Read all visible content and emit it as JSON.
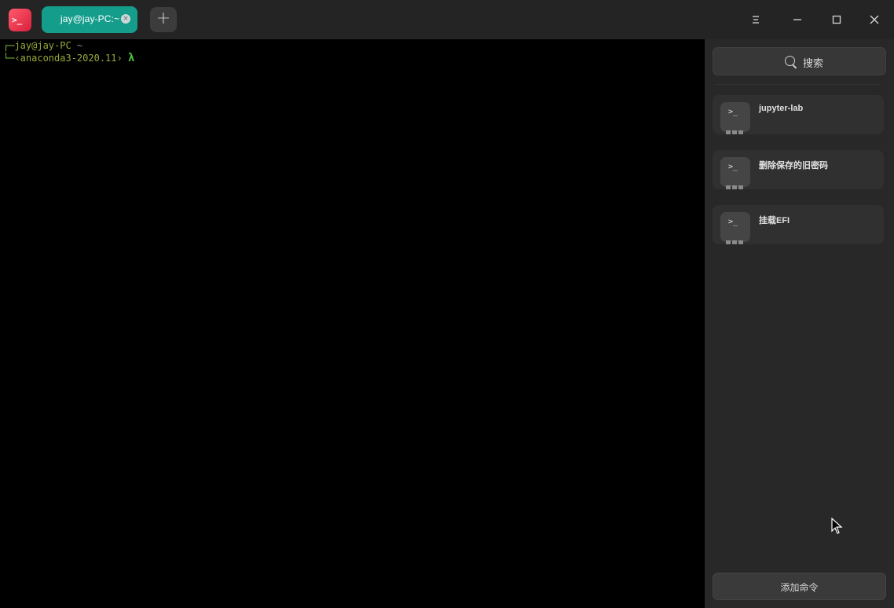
{
  "titlebar": {
    "app_icon_glyph": ">_",
    "tab_title": "jay@jay-PC:~",
    "tab_close_glyph": "×",
    "new_tab_glyph": "+",
    "menu_glyph": "☰",
    "minimize_glyph": "—",
    "maximize_glyph": "☐",
    "close_glyph": "✕"
  },
  "terminal": {
    "line1_corner": "┌─",
    "line1_user": "jay@jay-PC",
    "line1_dir": " ~",
    "line2_corner": "└─",
    "line2_env": "‹anaconda3-2020.11›",
    "line2_prompt": "λ"
  },
  "sidebar": {
    "search_label": "搜索",
    "commands": [
      {
        "label": "jupyter-lab",
        "icon_glyph": ">_"
      },
      {
        "label": "删除保存的旧密码",
        "icon_glyph": ">_"
      },
      {
        "label": "挂载EFI",
        "icon_glyph": ">_"
      }
    ],
    "add_command_label": "添加命令"
  },
  "colors": {
    "tab_active": "#159d8c",
    "app_icon": "#e0304a",
    "prompt_green": "#7fbf3f",
    "lambda_green": "#4cc43a"
  }
}
